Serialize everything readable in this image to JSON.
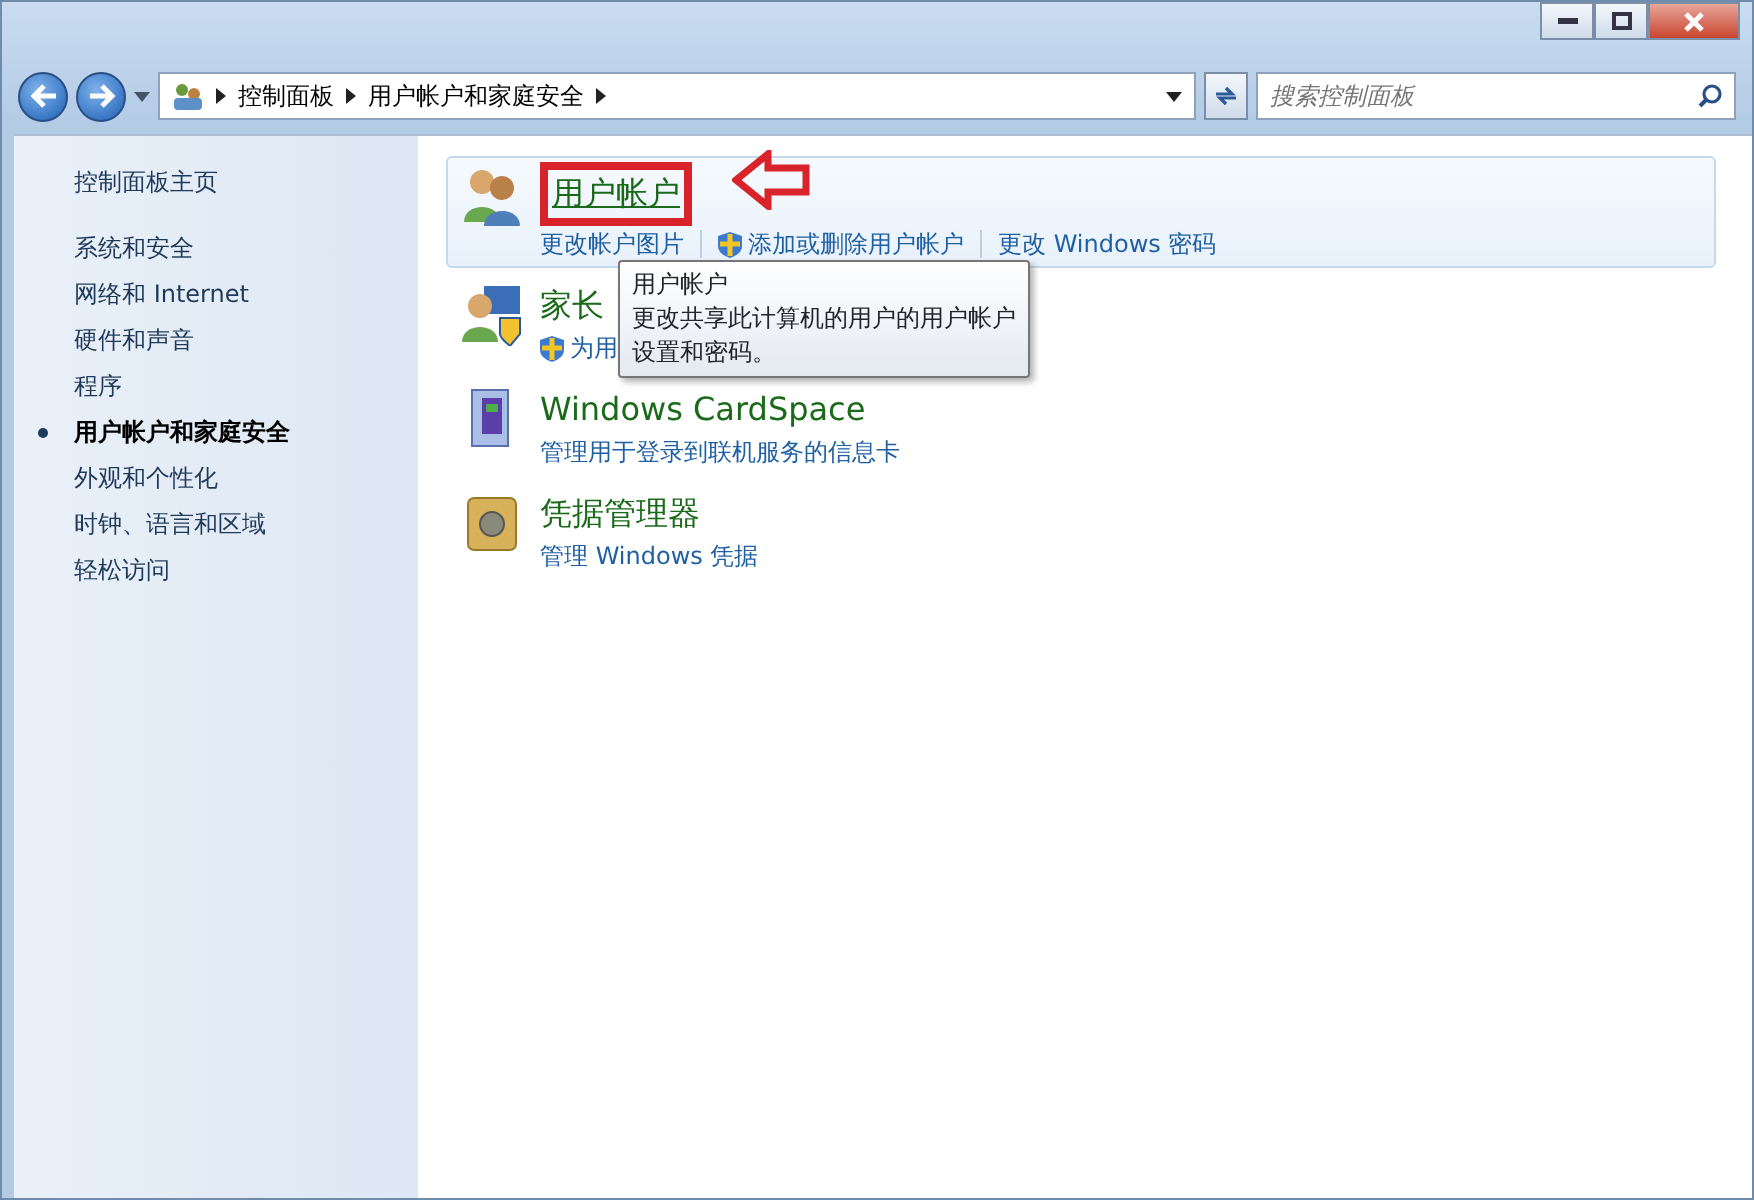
{
  "address": {
    "crumbs": [
      "控制面板",
      "用户帐户和家庭安全"
    ]
  },
  "search": {
    "placeholder": "搜索控制面板"
  },
  "sidebar": {
    "home": "控制面板主页",
    "items": [
      {
        "label": "系统和安全",
        "selected": false
      },
      {
        "label": "网络和 Internet",
        "selected": false
      },
      {
        "label": "硬件和声音",
        "selected": false
      },
      {
        "label": "程序",
        "selected": false
      },
      {
        "label": "用户帐户和家庭安全",
        "selected": true
      },
      {
        "label": "外观和个性化",
        "selected": false
      },
      {
        "label": "时钟、语言和区域",
        "selected": false
      },
      {
        "label": "轻松访问",
        "selected": false
      }
    ]
  },
  "categories": [
    {
      "kind": "users",
      "title": "用户帐户",
      "highlighted": true,
      "links": [
        {
          "label": "更改帐户图片",
          "shield": false
        },
        {
          "label": "添加或删除用户帐户",
          "shield": true
        },
        {
          "label": "更改 Windows 密码",
          "shield": false
        }
      ]
    },
    {
      "kind": "family",
      "title": "家长",
      "highlighted": false,
      "links": [
        {
          "label": "为用",
          "shield": true
        }
      ]
    },
    {
      "kind": "card",
      "title": "Windows CardSpace",
      "highlighted": false,
      "links": [
        {
          "label": "管理用于登录到联机服务的信息卡",
          "shield": false
        }
      ]
    },
    {
      "kind": "vault",
      "title": "凭据管理器",
      "highlighted": false,
      "links": [
        {
          "label": "管理 Windows 凭据",
          "shield": false
        }
      ]
    }
  ],
  "tooltip": {
    "title": "用户帐户",
    "lines": [
      "更改共享此计算机的用户的用户帐户",
      "设置和密码。"
    ]
  }
}
